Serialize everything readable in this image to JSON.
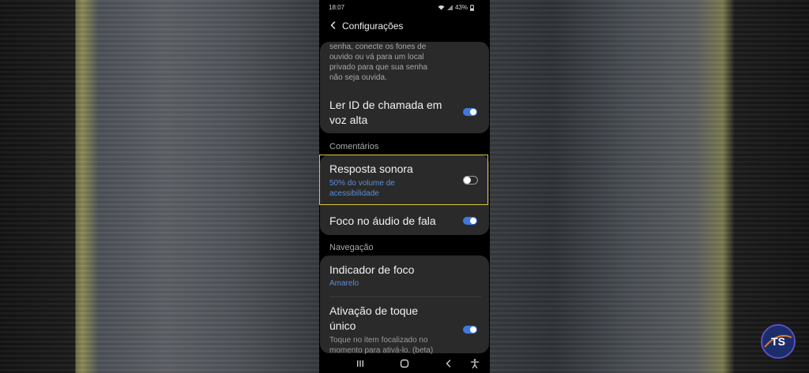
{
  "status_bar": {
    "time": "18:07",
    "battery": "43%"
  },
  "app_bar": {
    "title": "Configurações"
  },
  "top_card": {
    "description_lines": [
      "senha, conecte os fones de",
      "ouvido ou vá para um local",
      "privado para que sua senha",
      "não seja ouvida."
    ],
    "caller_id": {
      "label_line1": "Ler ID de chamada em",
      "label_line2": "voz alta",
      "enabled": true
    }
  },
  "sections": {
    "comments": "Comentários",
    "navigation": "Navegação"
  },
  "comments_card": {
    "sound_feedback": {
      "label": "Resposta sonora",
      "sub_line1": "50% do volume de",
      "sub_line2": "acessibilidade",
      "enabled": false
    },
    "speech_focus": {
      "label": "Foco no áudio de fala",
      "enabled": true
    }
  },
  "navigation_card": {
    "focus_indicator": {
      "label": "Indicador de foco",
      "value": "Amarelo"
    },
    "single_tap": {
      "label_line1": "Ativação de toque",
      "label_line2": "único",
      "desc_line1": "Toque no item focalizado no",
      "desc_line2": "momento para ativá-lo. (beta)",
      "enabled": true
    }
  },
  "colors": {
    "accent": "#3f78e0",
    "focus_frame": "#d8c53a",
    "card": "#2a2a2a"
  },
  "logo": {
    "text": "TS"
  }
}
